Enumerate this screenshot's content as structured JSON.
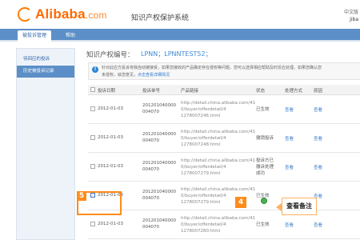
{
  "header": {
    "logo_text": "Alibaba",
    "logo_dotcom": ".com",
    "system_title": "知识产权保护系统",
    "lang": "中文版",
    "user": "jiba"
  },
  "nav": {
    "active_tab": "被投诉管理",
    "other_tab": "帮助"
  },
  "sidebar": {
    "items": [
      {
        "label": "待回应的投诉"
      },
      {
        "label": "历史被投诉记录"
      }
    ]
  },
  "main": {
    "ip_label": "知识产权编号：",
    "ip_value": "LPNN；LPNNTEST52；",
    "notice_line1": "针对此应方投诉将我自动被接受，如果您接收的产品确定存在侵权等问题，您可以选择相应帮助及时反应处理，如果您确认您",
    "notice_line2": "未侵权，就您意见，",
    "notice_link": "点击查看详细情况"
  },
  "table": {
    "headers": [
      "投诉日期",
      "投诉单号",
      "产品链接",
      "状态",
      "处理方式",
      "原因"
    ],
    "rows": [
      {
        "date": "2012-01-03",
        "id1": "201201040000",
        "id2": "004070",
        "url1": "http://detail.china.alibaba.com/41",
        "url2": "0/buyer/offerdetail/4",
        "url3": "1278007246.html",
        "status": [
          "已生效"
        ],
        "status2": "",
        "action": "查看",
        "action2": "查看",
        "checked": false
      },
      {
        "date": "2012-01-03",
        "id1": "201201040000",
        "id2": "004070",
        "url1": "http://detail.china.alibaba.com/41",
        "url2": "0/buyer/offerdetail/4",
        "url3": "1278007248.html",
        "status": [
          "撤销投诉"
        ],
        "status2": "",
        "action": "查看",
        "action2": "查看",
        "checked": false
      },
      {
        "date": "2012-01-03",
        "id1": "201201040000",
        "id2": "004070",
        "url1": "http://detail.china.alibaba.com/41",
        "url2": "0/buyer/offerdetail/4",
        "url3": "1278007279.html",
        "status": [
          "投诉方已",
          "撤诉处理",
          "成功"
        ],
        "status2": "",
        "action": "查看",
        "action2": "查看",
        "checked": false
      },
      {
        "date": "2012-01-03",
        "id1": "201201040000",
        "id2": "004070",
        "url1": "http://detail.china.alibaba.com/41",
        "url2": "0/buyer/offerdetail/4",
        "url3": "1278007279.html",
        "status": [
          "已生效"
        ],
        "status2": "",
        "action": "",
        "action2": "查看",
        "checked": true
      },
      {
        "date": "2012-01-03",
        "id1": "201201040000",
        "id2": "004070",
        "url1": "http://detail.china.alibaba.com/41",
        "url2": "0/buyer/offerdetail/4",
        "url3": "1278007280.html",
        "status": [
          "已生效"
        ],
        "status2": "",
        "action": "查看",
        "action2": "查看",
        "checked": false
      }
    ]
  },
  "annotations": {
    "num5": "5",
    "num4": "4",
    "callout": "查看备注"
  },
  "colors": {
    "brand": "#ff6a00",
    "nav": "#5c8fc7",
    "link": "#3d7fcf",
    "annotation": "#ff8c1a"
  }
}
